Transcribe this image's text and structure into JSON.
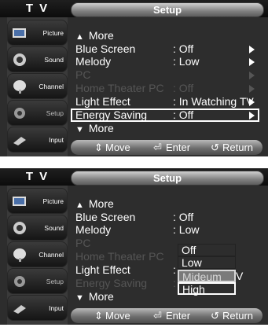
{
  "screens": [
    {
      "header": {
        "tv_label": "T V",
        "title": "Setup"
      },
      "sidebar": {
        "items": [
          {
            "label": "Picture",
            "icon": "picture-icon"
          },
          {
            "label": "Sound",
            "icon": "sound-icon"
          },
          {
            "label": "Channel",
            "icon": "channel-icon"
          },
          {
            "label": "Setup",
            "icon": "setup-icon"
          },
          {
            "label": "Input",
            "icon": "input-icon"
          }
        ]
      },
      "menu": {
        "more_top": "More",
        "rows": [
          {
            "label": "Blue Screen",
            "value": ": Off"
          },
          {
            "label": "Melody",
            "value": ": Low"
          },
          {
            "label": "PC",
            "value": ""
          },
          {
            "label": "Home Theater PC",
            "value": ": Off"
          },
          {
            "label": "Light Effect",
            "value": ": In Watching TV"
          },
          {
            "label": "Energy Saving",
            "value": ": Off"
          }
        ],
        "more_bottom": "More"
      },
      "footer": {
        "move": "Move",
        "enter": "Enter",
        "return": "Return"
      }
    },
    {
      "header": {
        "tv_label": "T V",
        "title": "Setup"
      },
      "sidebar": {
        "items": [
          {
            "label": "Picture",
            "icon": "picture-icon"
          },
          {
            "label": "Sound",
            "icon": "sound-icon"
          },
          {
            "label": "Channel",
            "icon": "channel-icon"
          },
          {
            "label": "Setup",
            "icon": "setup-icon"
          },
          {
            "label": "Input",
            "icon": "input-icon"
          }
        ]
      },
      "menu": {
        "more_top": "More",
        "rows": [
          {
            "label": "Blue Screen",
            "value": ": Off"
          },
          {
            "label": "Melody",
            "value": ": Low"
          },
          {
            "label": "PC",
            "value": ""
          },
          {
            "label": "Home Theater PC",
            "value": ""
          },
          {
            "label": "Light Effect",
            "value": ":"
          },
          {
            "label": "Energy Saving",
            "value": ":"
          }
        ],
        "more_bottom": "More"
      },
      "dropdown": {
        "options": [
          "Off",
          "Low",
          "Mideum",
          "High"
        ],
        "trailing": "V"
      },
      "footer": {
        "move": "Move",
        "enter": "Enter",
        "return": "Return"
      }
    }
  ],
  "colors": {
    "background": "#2d2d2d",
    "highlight": "#ffffff",
    "disabled_text": "#555555"
  }
}
